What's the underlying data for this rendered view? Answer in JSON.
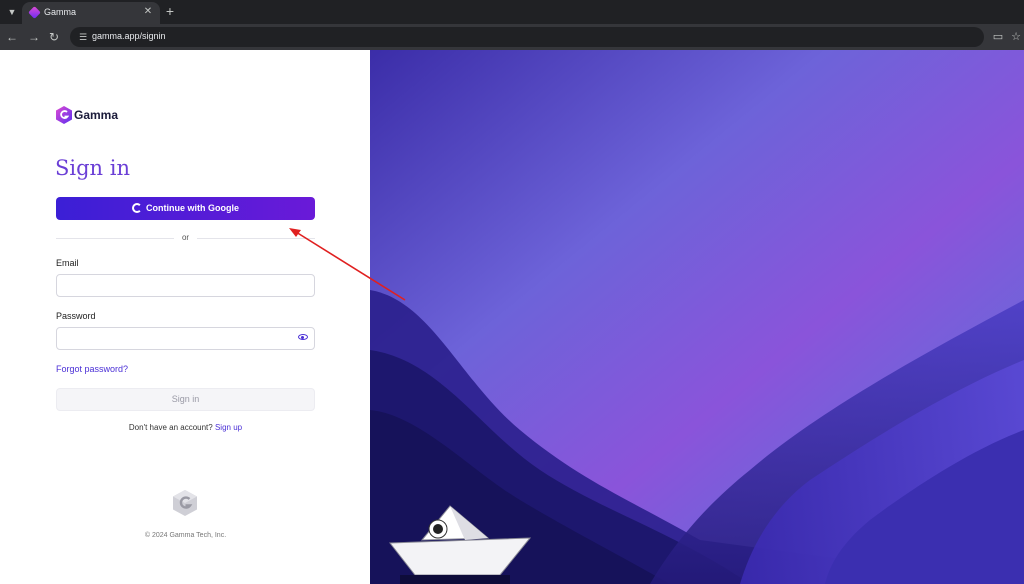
{
  "browser": {
    "tab_title": "Gamma",
    "tab_close": "✕",
    "new_tab": "+",
    "url": "gamma.app/signin"
  },
  "signin": {
    "logo_text": "Gamma",
    "heading": "Sign in",
    "google_button": "Continue with Google",
    "divider_text": "or",
    "email_label": "Email",
    "email_value": "",
    "password_label": "Password",
    "password_value": "",
    "forgot_password": "Forgot password?",
    "submit_button": "Sign in",
    "no_account_text": "Don't have an account?",
    "signup_link": "Sign up",
    "copyright": "© 2024 Gamma Tech, Inc."
  },
  "colors": {
    "brand_purple": "#6b3fd6",
    "button_gradient_start": "#3b1fd6",
    "button_gradient_end": "#6a1ad8",
    "link": "#4a2fd6",
    "annotation_arrow": "#e02020"
  },
  "icons": {
    "tab_menu": "chevron-down-icon",
    "favicon": "gamma-favicon-icon",
    "back": "back-arrow-icon",
    "forward": "forward-arrow-icon",
    "reload": "reload-icon",
    "site_info": "tune-icon",
    "cast": "cast-icon",
    "bookmark": "star-icon",
    "google": "google-g-icon",
    "password_toggle": "eye-icon"
  }
}
